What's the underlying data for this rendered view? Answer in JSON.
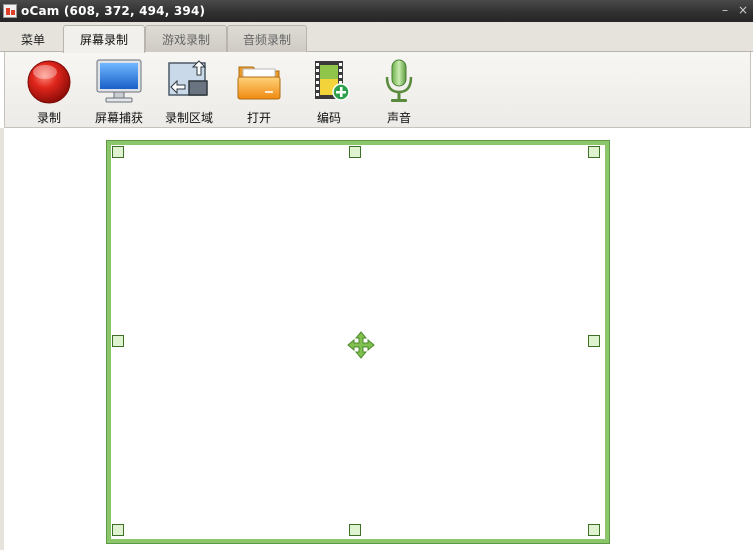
{
  "window": {
    "title": "oCam (608, 372, 494, 394)",
    "controls": [
      "–",
      "×"
    ]
  },
  "tabs": [
    {
      "label": "菜单",
      "state": "plain"
    },
    {
      "label": "屏幕录制",
      "state": "active"
    },
    {
      "label": "游戏录制",
      "state": "inactive"
    },
    {
      "label": "音频录制",
      "state": "inactive"
    }
  ],
  "toolbar": {
    "items": [
      {
        "label": "录制",
        "icon": "record-icon"
      },
      {
        "label": "屏幕捕获",
        "icon": "screen-capture-icon"
      },
      {
        "label": "录制区域",
        "icon": "record-area-icon"
      },
      {
        "label": "打开",
        "icon": "folder-icon"
      },
      {
        "label": "编码",
        "icon": "codec-icon"
      },
      {
        "label": "声音",
        "icon": "microphone-icon"
      }
    ]
  },
  "colors": {
    "titlebar": "#2f2f2f",
    "region_border": "#8cc66b",
    "handle_fill": "#e0f3d0",
    "record_red": "#e0261c"
  }
}
